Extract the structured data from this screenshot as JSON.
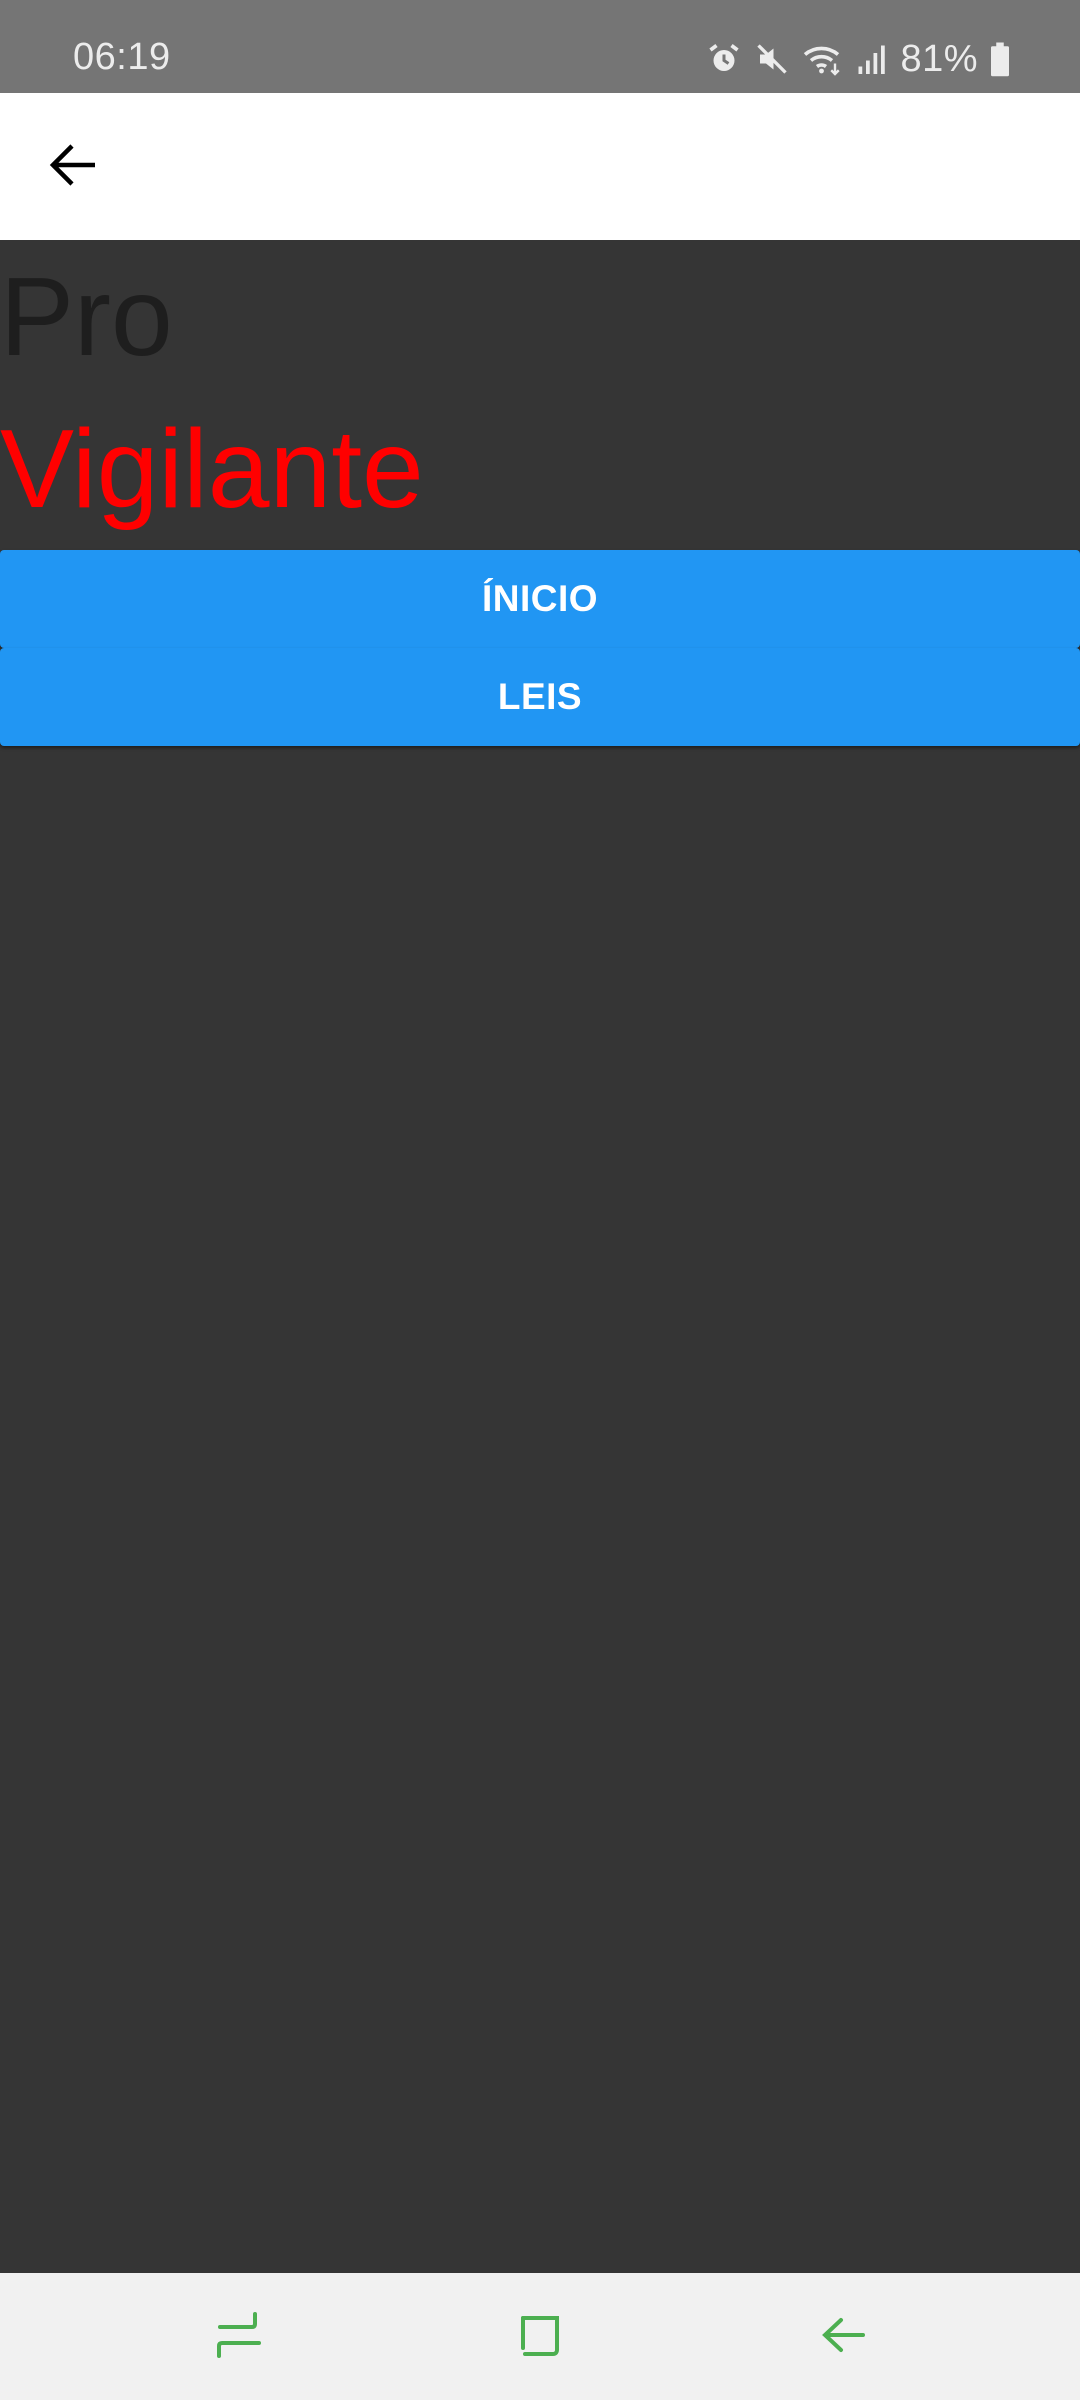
{
  "status_bar": {
    "time": "06:19",
    "battery_text": "81%",
    "icons": [
      "alarm-icon",
      "mute-icon",
      "wifi-icon",
      "signal-icon",
      "battery-icon"
    ]
  },
  "app_bar": {
    "back_icon": "arrow-back-icon"
  },
  "main": {
    "title_line1": "Pro",
    "title_line2": "Vigilante",
    "buttons": [
      {
        "label": "ÍNICIO"
      },
      {
        "label": "LEIS"
      }
    ]
  },
  "nav_bar": {
    "icons": [
      "recents-icon",
      "home-icon",
      "back-icon"
    ]
  },
  "colors": {
    "status_bar": "#757575",
    "content_bg": "#353535",
    "accent": "#2196f3",
    "title_red": "#ff0000",
    "title_dark": "#1e1e1e",
    "nav_icon": "#4caf50"
  }
}
